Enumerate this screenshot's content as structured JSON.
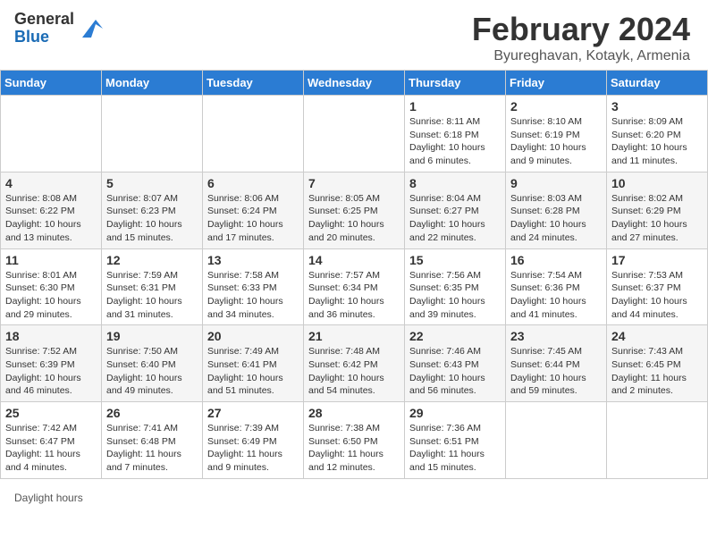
{
  "header": {
    "logo_general": "General",
    "logo_blue": "Blue",
    "month_year": "February 2024",
    "location": "Byureghavan, Kotayk, Armenia"
  },
  "days_of_week": [
    "Sunday",
    "Monday",
    "Tuesday",
    "Wednesday",
    "Thursday",
    "Friday",
    "Saturday"
  ],
  "weeks": [
    [
      {
        "day": "",
        "info": ""
      },
      {
        "day": "",
        "info": ""
      },
      {
        "day": "",
        "info": ""
      },
      {
        "day": "",
        "info": ""
      },
      {
        "day": "1",
        "info": "Sunrise: 8:11 AM\nSunset: 6:18 PM\nDaylight: 10 hours\nand 6 minutes."
      },
      {
        "day": "2",
        "info": "Sunrise: 8:10 AM\nSunset: 6:19 PM\nDaylight: 10 hours\nand 9 minutes."
      },
      {
        "day": "3",
        "info": "Sunrise: 8:09 AM\nSunset: 6:20 PM\nDaylight: 10 hours\nand 11 minutes."
      }
    ],
    [
      {
        "day": "4",
        "info": "Sunrise: 8:08 AM\nSunset: 6:22 PM\nDaylight: 10 hours\nand 13 minutes."
      },
      {
        "day": "5",
        "info": "Sunrise: 8:07 AM\nSunset: 6:23 PM\nDaylight: 10 hours\nand 15 minutes."
      },
      {
        "day": "6",
        "info": "Sunrise: 8:06 AM\nSunset: 6:24 PM\nDaylight: 10 hours\nand 17 minutes."
      },
      {
        "day": "7",
        "info": "Sunrise: 8:05 AM\nSunset: 6:25 PM\nDaylight: 10 hours\nand 20 minutes."
      },
      {
        "day": "8",
        "info": "Sunrise: 8:04 AM\nSunset: 6:27 PM\nDaylight: 10 hours\nand 22 minutes."
      },
      {
        "day": "9",
        "info": "Sunrise: 8:03 AM\nSunset: 6:28 PM\nDaylight: 10 hours\nand 24 minutes."
      },
      {
        "day": "10",
        "info": "Sunrise: 8:02 AM\nSunset: 6:29 PM\nDaylight: 10 hours\nand 27 minutes."
      }
    ],
    [
      {
        "day": "11",
        "info": "Sunrise: 8:01 AM\nSunset: 6:30 PM\nDaylight: 10 hours\nand 29 minutes."
      },
      {
        "day": "12",
        "info": "Sunrise: 7:59 AM\nSunset: 6:31 PM\nDaylight: 10 hours\nand 31 minutes."
      },
      {
        "day": "13",
        "info": "Sunrise: 7:58 AM\nSunset: 6:33 PM\nDaylight: 10 hours\nand 34 minutes."
      },
      {
        "day": "14",
        "info": "Sunrise: 7:57 AM\nSunset: 6:34 PM\nDaylight: 10 hours\nand 36 minutes."
      },
      {
        "day": "15",
        "info": "Sunrise: 7:56 AM\nSunset: 6:35 PM\nDaylight: 10 hours\nand 39 minutes."
      },
      {
        "day": "16",
        "info": "Sunrise: 7:54 AM\nSunset: 6:36 PM\nDaylight: 10 hours\nand 41 minutes."
      },
      {
        "day": "17",
        "info": "Sunrise: 7:53 AM\nSunset: 6:37 PM\nDaylight: 10 hours\nand 44 minutes."
      }
    ],
    [
      {
        "day": "18",
        "info": "Sunrise: 7:52 AM\nSunset: 6:39 PM\nDaylight: 10 hours\nand 46 minutes."
      },
      {
        "day": "19",
        "info": "Sunrise: 7:50 AM\nSunset: 6:40 PM\nDaylight: 10 hours\nand 49 minutes."
      },
      {
        "day": "20",
        "info": "Sunrise: 7:49 AM\nSunset: 6:41 PM\nDaylight: 10 hours\nand 51 minutes."
      },
      {
        "day": "21",
        "info": "Sunrise: 7:48 AM\nSunset: 6:42 PM\nDaylight: 10 hours\nand 54 minutes."
      },
      {
        "day": "22",
        "info": "Sunrise: 7:46 AM\nSunset: 6:43 PM\nDaylight: 10 hours\nand 56 minutes."
      },
      {
        "day": "23",
        "info": "Sunrise: 7:45 AM\nSunset: 6:44 PM\nDaylight: 10 hours\nand 59 minutes."
      },
      {
        "day": "24",
        "info": "Sunrise: 7:43 AM\nSunset: 6:45 PM\nDaylight: 11 hours\nand 2 minutes."
      }
    ],
    [
      {
        "day": "25",
        "info": "Sunrise: 7:42 AM\nSunset: 6:47 PM\nDaylight: 11 hours\nand 4 minutes."
      },
      {
        "day": "26",
        "info": "Sunrise: 7:41 AM\nSunset: 6:48 PM\nDaylight: 11 hours\nand 7 minutes."
      },
      {
        "day": "27",
        "info": "Sunrise: 7:39 AM\nSunset: 6:49 PM\nDaylight: 11 hours\nand 9 minutes."
      },
      {
        "day": "28",
        "info": "Sunrise: 7:38 AM\nSunset: 6:50 PM\nDaylight: 11 hours\nand 12 minutes."
      },
      {
        "day": "29",
        "info": "Sunrise: 7:36 AM\nSunset: 6:51 PM\nDaylight: 11 hours\nand 15 minutes."
      },
      {
        "day": "",
        "info": ""
      },
      {
        "day": "",
        "info": ""
      }
    ]
  ],
  "footer": {
    "note": "Daylight hours"
  }
}
